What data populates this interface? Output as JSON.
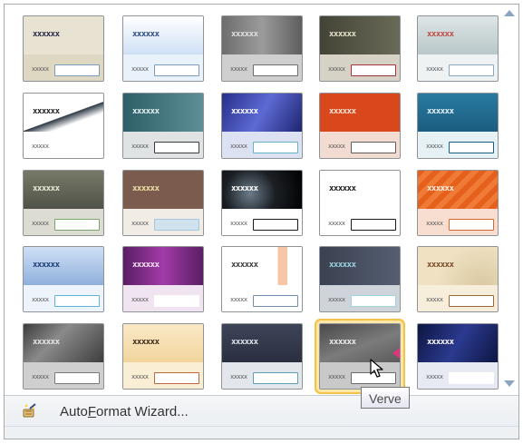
{
  "styles": [
    {
      "name": "",
      "title_text": "xxxxxx",
      "label_text": "xxxxx",
      "header": "#e8e2d2",
      "body": "#ded8c3",
      "title_color": "#2b2b4a",
      "box_border": "#7d9bbd",
      "box_fill": "#ffffff"
    },
    {
      "name": "",
      "title_text": "xxxxxx",
      "label_text": "xxxxx",
      "header": "linear-gradient(#ffffff,#cfe0f5)",
      "body": "#e9f1fb",
      "title_color": "#2b4a86",
      "box_border": "#7d9bbd",
      "box_fill": "#ffffff"
    },
    {
      "name": "",
      "title_text": "xxxxxx",
      "label_text": "xxxxx",
      "header": "linear-gradient(90deg,#6d6d6d,#9b9b9b,#5e5e5e)",
      "body": "#cfcfcf",
      "title_color": "#e0e0e0",
      "box_border": "#6d6d6d",
      "box_fill": "#ffffff"
    },
    {
      "name": "",
      "title_text": "xxxxxx",
      "label_text": "xxxxx",
      "header": "linear-gradient(90deg,#434436,#6a6a58)",
      "body": "#d6d3c6",
      "title_color": "#e6e2cc",
      "box_border": "#a3333b",
      "box_fill": "#ffffff"
    },
    {
      "name": "",
      "title_text": "xxxxxx",
      "label_text": "xxxxx",
      "header": "linear-gradient(#dfe5e6,#b8c7c8)",
      "body": "#eef2f2",
      "title_color": "#c24b45",
      "box_border": "#8aa8bd",
      "box_fill": "#ffffff"
    },
    {
      "name": "",
      "title_text": "xxxxxx",
      "label_text": "xxxxx",
      "header": "linear-gradient(160deg,#ffffff 55%,#2f3a46 56%,#ffffff 72%)",
      "body": "#ffffff",
      "title_color": "#222222",
      "box_border": "#ffffff",
      "box_fill": "#ffffff"
    },
    {
      "name": "",
      "title_text": "xxxxxx",
      "label_text": "xxxxx",
      "header": "linear-gradient(90deg,#2c5f67,#5e8f97)",
      "body": "#dfe3e4",
      "title_color": "#e6f1f3",
      "box_border": "#3b3b3b",
      "box_fill": "#ffffff"
    },
    {
      "name": "",
      "title_text": "xxxxxx",
      "label_text": "xxxxx",
      "header": "linear-gradient(120deg,#262f8a,#5d6ad4,#1d2570)",
      "body": "#dde2f2",
      "title_color": "#ffffff",
      "box_border": "#63b2c8",
      "box_fill": "#ffffff"
    },
    {
      "name": "",
      "title_text": "xxxxxx",
      "label_text": "xxxxx",
      "header": "#d9481d",
      "body": "#f2dcd2",
      "title_color": "#fde3d5",
      "box_border": "#5d5d5d",
      "box_fill": "#ffffff"
    },
    {
      "name": "",
      "title_text": "xxxxxx",
      "label_text": "xxxxx",
      "header": "linear-gradient(#2a7aa0,#1b5d80)",
      "body": "#e6f1f6",
      "title_color": "#e6f3fa",
      "box_border": "#1b5d80",
      "box_fill": "#ffffff"
    },
    {
      "name": "",
      "title_text": "xxxxxx",
      "label_text": "xxxxx",
      "header": "linear-gradient(#777a68,#4f5247)",
      "body": "#dcdcd2",
      "title_color": "#ebebd8",
      "box_border": "#78a86a",
      "box_fill": "#ffffff"
    },
    {
      "name": "",
      "title_text": "xxxxxx",
      "label_text": "xxxxx",
      "header": "#7b5b4d",
      "body": "#f2ece6",
      "title_color": "#f0e0a8",
      "box_border": "#a7c7da",
      "box_fill": "#cfe2ee"
    },
    {
      "name": "",
      "title_text": "xxxxxx",
      "label_text": "xxxxx",
      "header": "radial-gradient(circle at 35% 60%,#6c7c8a,#1b1f24 45%,#000000)",
      "body": "#ffffff",
      "title_color": "#ffffff",
      "box_border": "#1a1a1a",
      "box_fill": "#ffffff"
    },
    {
      "name": "",
      "title_text": "xxxxxx",
      "label_text": "xxxxx",
      "header": "#ffffff",
      "body": "#ffffff",
      "title_color": "#1a1a1a",
      "box_border": "#1a1a1a",
      "box_fill": "#ffffff"
    },
    {
      "name": "",
      "title_text": "xxxxxx",
      "label_text": "xxxxx",
      "header": "repeating-linear-gradient(135deg,#e5601b 0 6px,#ef7b36 6px 12px)",
      "body": "#f7ded0",
      "title_color": "#fff0e6",
      "box_border": "#d66a2c",
      "box_fill": "#ffffff"
    },
    {
      "name": "",
      "title_text": "xxxxxx",
      "label_text": "xxxxx",
      "header": "linear-gradient(#cfe0f5,#8fb0dc)",
      "body": "#eef4fb",
      "title_color": "#1f3c79",
      "box_border": "#5fb4d9",
      "box_fill": "#ffffff"
    },
    {
      "name": "",
      "title_text": "xxxxxx",
      "label_text": "xxxxx",
      "header": "linear-gradient(90deg,#5a1e63,#a23ba8,#5a1e63)",
      "body": "#efe4f0",
      "title_color": "#f6e4f6",
      "box_border": "#ffffff",
      "box_fill": "#ffffff"
    },
    {
      "name": "",
      "title_text": "xxxxxx",
      "label_text": "xxxxx",
      "header": "linear-gradient(90deg,#ffffff 70%,#f6c6a6 70%,#f6c6a6 82%,#ffffff 82%)",
      "body": "#ffffff",
      "title_color": "#3a3a3a",
      "box_border": "#6f8fb7",
      "box_fill": "#ffffff"
    },
    {
      "name": "",
      "title_text": "xxxxxx",
      "label_text": "xxxxx",
      "header": "linear-gradient(90deg,#3a4150,#555e72)",
      "body": "#cfd3da",
      "title_color": "#9ed3e2",
      "box_border": "#9ed3e2",
      "box_fill": "#ffffff"
    },
    {
      "name": "",
      "title_text": "xxxxxx",
      "label_text": "xxxxx",
      "header": "radial-gradient(circle at 80% 110%,#d9c8a0,#efe1c2 60%)",
      "body": "#f6eddb",
      "title_color": "#7a4a26",
      "box_border": "#9a6a3a",
      "box_fill": "#ffffff"
    },
    {
      "name": "",
      "title_text": "xxxxxx",
      "label_text": "xxxxx",
      "header": "linear-gradient(135deg,#3d3d3d,#8a8a8a 40%,#3d3d3d)",
      "body": "#cfcfcf",
      "title_color": "#e6e6e6",
      "box_border": "#7a7a7a",
      "box_fill": "#ffffff"
    },
    {
      "name": "",
      "title_text": "xxxxxx",
      "label_text": "xxxxx",
      "header": "linear-gradient(#fbe9c7,#f0d59c)",
      "body": "#faeed5",
      "title_color": "#3a2a1a",
      "box_border": "#c0683c",
      "box_fill": "#ffffff"
    },
    {
      "name": "",
      "title_text": "xxxxxx",
      "label_text": "xxxxx",
      "header": "linear-gradient(#3e4458,#2a2f40)",
      "body": "#e3e6ea",
      "title_color": "#dfe6ee",
      "box_border": "#5a9fb5",
      "box_fill": "#ffffff"
    },
    {
      "name": "Verve",
      "title_text": "xxxxxx",
      "label_text": "xxxxx",
      "header": "linear-gradient(160deg,#4a4a4a,#7b7b7b 55%,#5b5b5b)",
      "body": "#c9c9c9",
      "title_color": "#ededed",
      "box_border": "#6a6a6a",
      "box_fill": "#ffffff",
      "accent": "#e1347e"
    },
    {
      "name": "",
      "title_text": "xxxxxx",
      "label_text": "xxxxx",
      "header": "linear-gradient(120deg,#0d1642,#2b3a8f,#0d1642)",
      "body": "#e7eaf3",
      "title_color": "#ffffff",
      "box_border": "#ffffff",
      "box_fill": "#ffffff"
    }
  ],
  "footer": {
    "wizard_label_pre": "Auto",
    "wizard_label_accel": "F",
    "wizard_label_post": "ormat Wizard..."
  },
  "tooltip": {
    "text": "Verve"
  },
  "colors": {
    "hover_outline": "#f2c24a",
    "gallery_border": "#a7abb0",
    "scroll_arrow": "#8aa5c4"
  },
  "icons": {
    "wizard": "wand-icon",
    "scroll_up": "scroll-up-icon",
    "scroll_down": "scroll-down-icon",
    "cursor": "mouse-pointer-icon"
  }
}
